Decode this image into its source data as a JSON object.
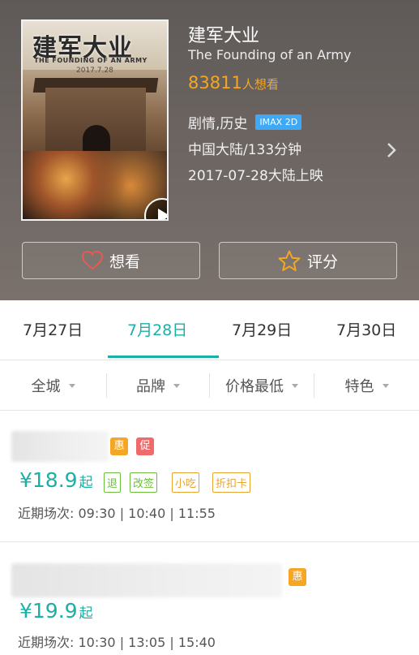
{
  "movie": {
    "poster_title": "建军大业",
    "poster_subtitle": "THE FOUNDING OF AN ARMY",
    "poster_date": "2017.7.28",
    "title": "建军大业",
    "english_title": "The Founding of an Army",
    "want_count": "83811",
    "want_label": "人想看",
    "genre": "剧情,历史",
    "format_badge": "IMAX 2D",
    "country_duration": "中国大陆/133分钟",
    "release": "2017-07-28大陆上映"
  },
  "actions": {
    "want_label": "想看",
    "rate_label": "评分"
  },
  "dates": [
    {
      "label": "7月27日",
      "active": false
    },
    {
      "label": "7月28日",
      "active": true
    },
    {
      "label": "7月29日",
      "active": false
    },
    {
      "label": "7月30日",
      "active": false
    }
  ],
  "filters": [
    "全城",
    "品牌",
    "价格最低",
    "特色"
  ],
  "cinemas": [
    {
      "badges": [
        "惠",
        "促"
      ],
      "price": "¥18.9",
      "price_suffix": "起",
      "features": [
        "退",
        "改签",
        "小吃",
        "折扣卡"
      ],
      "showtimes_label": "近期场次:",
      "showtimes": "09:30 | 10:40 | 11:55"
    },
    {
      "badges": [
        "惠"
      ],
      "price": "¥19.9",
      "price_suffix": "起",
      "features": [],
      "showtimes_label": "近期场次:",
      "showtimes": "10:30 | 13:05 | 15:40"
    }
  ],
  "colors": {
    "accent": "#1bb0a6",
    "want": "#f5a623",
    "imax": "#3fa9f5",
    "promo_hui": "#f5a623",
    "promo_cu": "#ef6b6b"
  }
}
